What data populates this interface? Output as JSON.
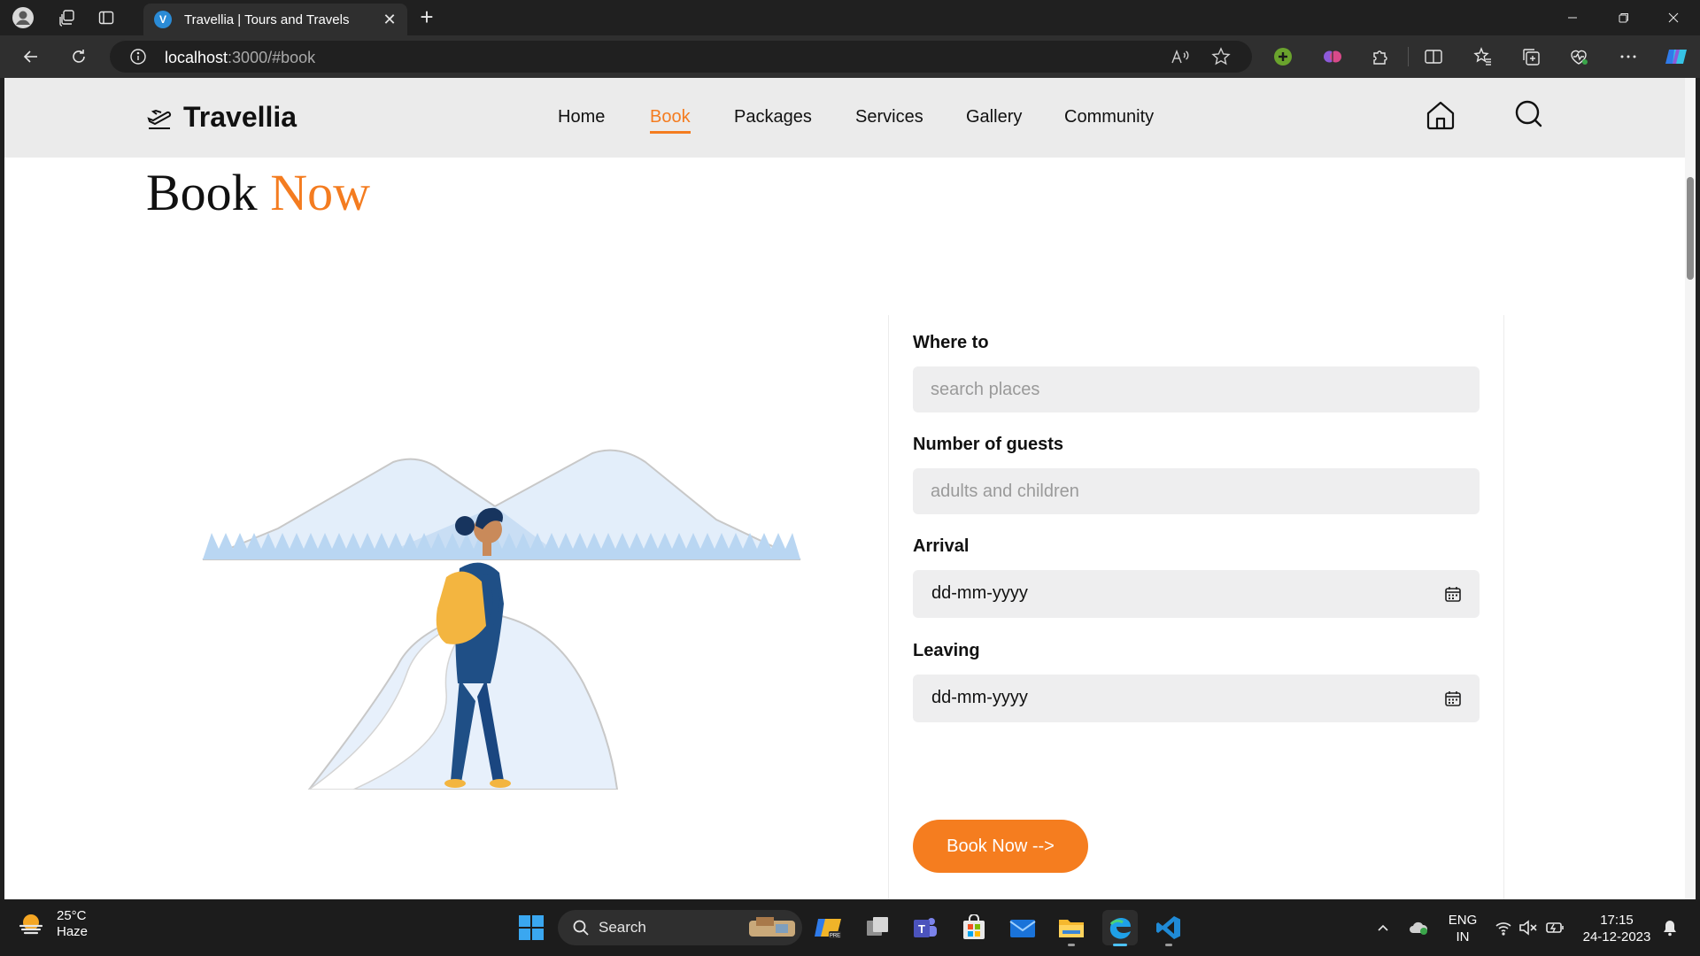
{
  "browser": {
    "tab": {
      "title": "Travellia | Tours and Travels",
      "favicon_letter": "V"
    },
    "address": {
      "host": "localhost",
      "rest": ":3000/#book"
    },
    "colors": {
      "chrome": "#202020",
      "toolbar": "#2f2f2f"
    }
  },
  "site": {
    "brand": "Travellia",
    "nav": [
      "Home",
      "Book",
      "Packages",
      "Services",
      "Gallery",
      "Community"
    ],
    "active_nav": "Book",
    "accent_color": "#f47c20",
    "header_icons": [
      "home-icon",
      "search-icon"
    ]
  },
  "page": {
    "heading_main": "Book",
    "heading_accent": "Now"
  },
  "form": {
    "where_label": "Where to",
    "where_placeholder": "search places",
    "guests_label": "Number of guests",
    "guests_placeholder": "adults and children",
    "arrival_label": "Arrival",
    "arrival_value": "dd-mm-yyyy",
    "leaving_label": "Leaving",
    "leaving_value": "dd-mm-yyyy",
    "submit_label": "Book Now -->"
  },
  "taskbar": {
    "weather_temp": "25°C",
    "weather_cond": "Haze",
    "search_label": "Search",
    "lang_top": "ENG",
    "lang_bottom": "IN",
    "time": "17:15",
    "date": "24-12-2023"
  }
}
